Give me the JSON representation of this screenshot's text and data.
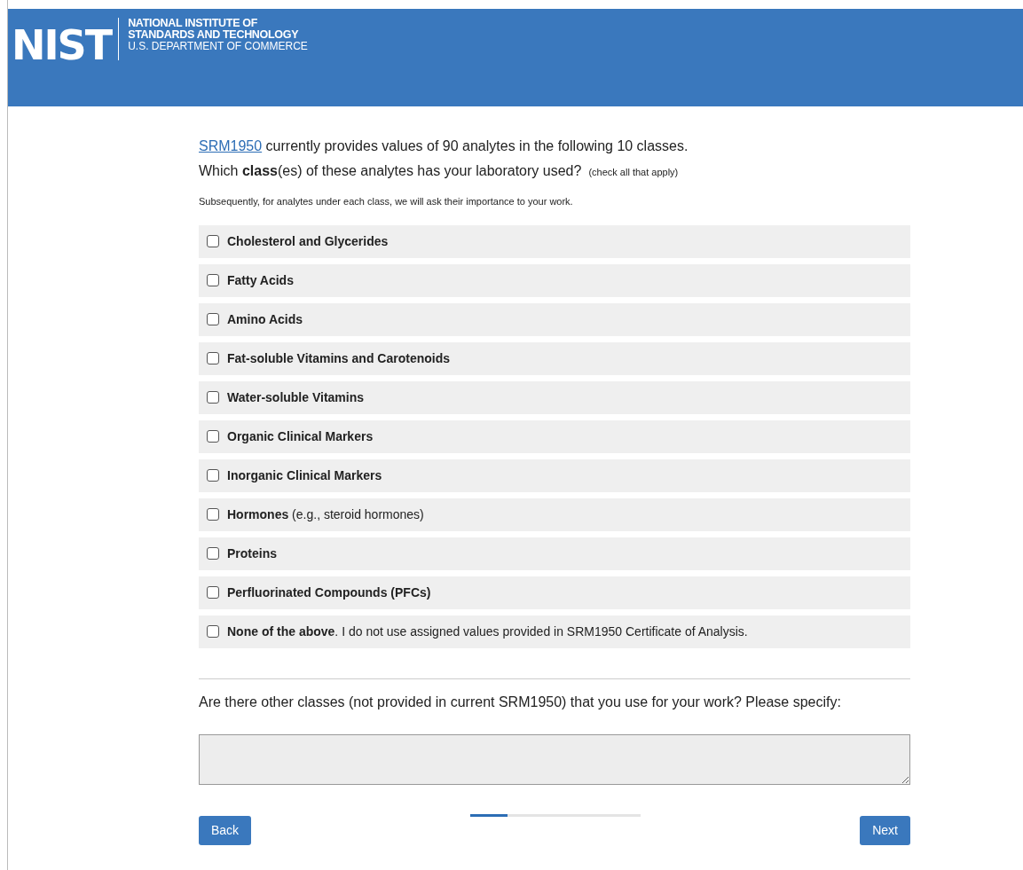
{
  "header": {
    "logo": "NIST",
    "org_lines": [
      "NATIONAL INSTITUTE OF",
      "STANDARDS AND TECHNOLOGY",
      "U.S. DEPARTMENT OF COMMERCE"
    ]
  },
  "intro": {
    "link": "SRM1950",
    "line1_rest": " currently provides values of 90 analytes in the following 10 classes.",
    "question": "Which **class**(es) of these analytes has your laboratory used?",
    "hint": "(check all that apply)",
    "note": "Subsequently, for analytes under each class, we will ask their importance to your work."
  },
  "classes": [
    {
      "label": "Cholesterol and Glycerides",
      "bold": true,
      "checked": false
    },
    {
      "label": "Fatty Acids",
      "bold": true,
      "checked": false
    },
    {
      "label": "Amino Acids",
      "bold": true,
      "checked": false
    },
    {
      "label": "Fat-soluble Vitamins and Carotenoids",
      "bold": true,
      "checked": false
    },
    {
      "label": "Water-soluble Vitamins",
      "bold": true,
      "checked": false
    },
    {
      "label": "Organic Clinical Markers",
      "bold": true,
      "checked": false
    },
    {
      "label": "Inorganic Clinical Markers",
      "bold": true,
      "checked": false
    },
    {
      "label": "**Hormones** (e.g., steroid hormones)",
      "bold": false,
      "checked": false
    },
    {
      "label": "Proteins",
      "bold": true,
      "checked": false
    },
    {
      "label": "Perfluorinated Compounds (PFCs)",
      "bold": true,
      "checked": false
    },
    {
      "label": "**None of the above**. I do not use assigned values provided in SRM1950 Certificate of Analysis.",
      "bold": false,
      "checked": false
    }
  ],
  "other": {
    "question": "Are there other classes (not provided in current SRM1950) that you use for your work? Please specify:"
  },
  "progress": {
    "level": 0.22
  },
  "buttons": {
    "back": "Back",
    "next": "Next"
  }
}
